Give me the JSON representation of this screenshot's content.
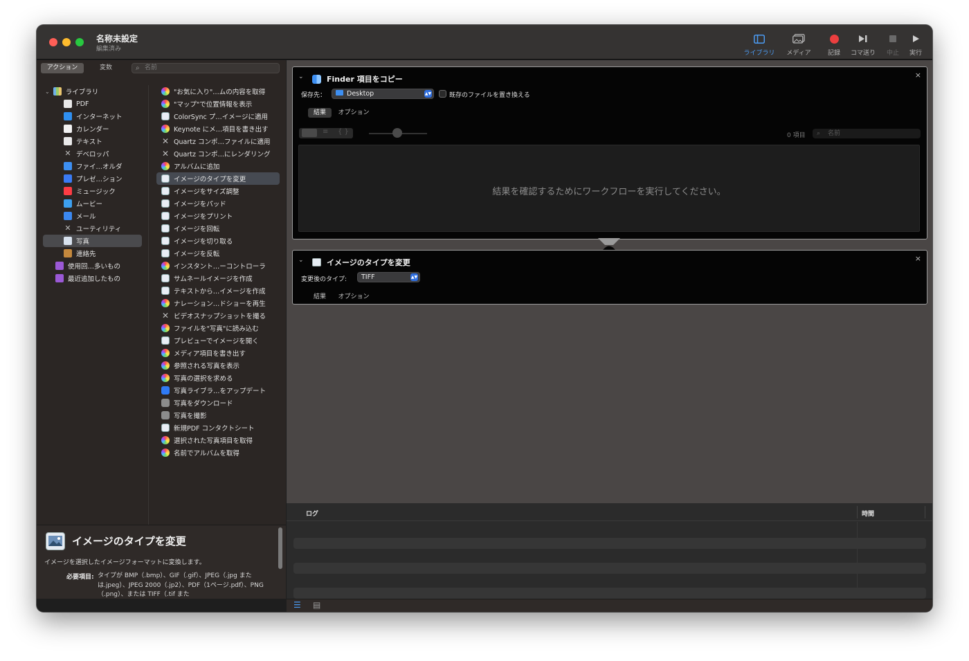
{
  "window": {
    "title": "名称未設定",
    "subtitle": "編集済み"
  },
  "toolbar": {
    "library": "ライブラリ",
    "media": "メディア",
    "record": "記録",
    "step": "コマ送り",
    "stop": "中止",
    "run": "実行"
  },
  "sidebar": {
    "tab_actions": "アクション",
    "tab_variables": "変数",
    "search_placeholder": "名前",
    "library_label": "ライブラリ",
    "categories": [
      "PDF",
      "インターネット",
      "カレンダー",
      "テキスト",
      "デベロッパ",
      "ファイ…オルダ",
      "プレゼ…ション",
      "ミュージック",
      "ムービー",
      "メール",
      "ユーティリティ",
      "写真",
      "連絡先"
    ],
    "smart_groups": [
      "使用回…多いもの",
      "最近追加したもの"
    ],
    "actions": [
      "\"お気に入り\"…ムの内容を取得",
      "\"マップ\"で位置情報を表示",
      "ColorSync プ…イメージに適用",
      "Keynote にメ…項目を書き出す",
      "Quartz コンポ…ファイルに適用",
      "Quartz コンポ…にレンダリング",
      "アルバムに追加",
      "イメージのタイプを変更",
      "イメージをサイズ調整",
      "イメージをパッド",
      "イメージをプリント",
      "イメージを回転",
      "イメージを切り取る",
      "イメージを反転",
      "インスタント…ーコントローラ",
      "サムネールイメージを作成",
      "テキストから…イメージを作成",
      "ナレーション…ドショーを再生",
      "ビデオスナップショットを撮る",
      "ファイルを\"写真\"に読み込む",
      "プレビューでイメージを開く",
      "メディア項目を書き出す",
      "参照される写真を表示",
      "写真の選択を求める",
      "写真ライブラ…をアップデート",
      "写真をダウンロード",
      "写真を撮影",
      "新規PDF コンタクトシート",
      "選択された写真項目を取得",
      "名前でアルバムを取得"
    ]
  },
  "description": {
    "title": "イメージのタイプを変更",
    "text": "イメージを選択したイメージフォーマットに変換します。",
    "required_label": "必要項目:",
    "required_text": "タイプが BMP（.bmp）、GIF（.gif）、JPEG（.jpg または.jpeg）、JPEG 2000（.jp2）、PDF（1ページ.pdf）、PNG（.png）、または TIFF（.tif また"
  },
  "workflow": {
    "card1": {
      "title": "Finder 項目をコピー",
      "dest_label": "保存先：",
      "dest_value": "Desktop",
      "replace_label": "既存のファイルを置き換える",
      "tab_results": "結果",
      "tab_options": "オプション",
      "item_count": "0 項目",
      "search_placeholder": "名前",
      "result_message": "結果を確認するためにワークフローを実行してください。"
    },
    "card2": {
      "title": "イメージのタイプを変更",
      "type_label": "変更後のタイプ:",
      "type_value": "TIFF",
      "tab_results": "結果",
      "tab_options": "オプション"
    }
  },
  "log": {
    "col_log": "ログ",
    "col_time": "時間"
  }
}
